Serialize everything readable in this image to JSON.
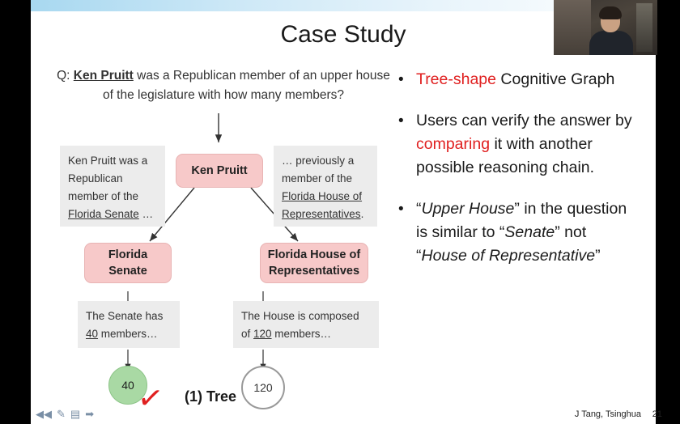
{
  "slide": {
    "title": "Case Study",
    "page_number": "21",
    "attribution": "J Tang, Tsinghua"
  },
  "question": {
    "prefix": "Q: ",
    "entity": "Ken Pruitt",
    "rest": " was a Republican member of an upper house of the legislature with how many members?"
  },
  "graph": {
    "caption": "(1) Tree",
    "check_mark": "✓",
    "left_context_box": {
      "line1": "Ken Pruitt was a",
      "line2": "Republican",
      "line3": "member of the",
      "underlined": "Florida Senate",
      "tail": " …"
    },
    "root_node": "Ken Pruitt",
    "right_context_box": {
      "line1": "… previously a",
      "line2": "member of the",
      "underlined1": "Florida House of",
      "underlined2": "Representatives",
      "tail": "."
    },
    "left_node_line1": "Florida",
    "left_node_line2": "Senate",
    "right_node_line1": "Florida House of",
    "right_node_line2": "Representatives",
    "left_evidence": {
      "pre": "The Senate has ",
      "number": "40",
      "post": " members…"
    },
    "right_evidence": {
      "pre": "The House is composed",
      "pre2": "of ",
      "number": "120",
      "post": " members…"
    },
    "left_answer": "40",
    "right_answer": "120"
  },
  "bullets": [
    {
      "marker": "•",
      "segments": [
        {
          "text": "Tree-shape",
          "style": "red"
        },
        {
          "text": " Cognitive Graph",
          "style": "plain"
        }
      ]
    },
    {
      "marker": "•",
      "segments": [
        {
          "text": "Users can verify the answer by ",
          "style": "plain"
        },
        {
          "text": "comparing",
          "style": "red"
        },
        {
          "text": " it with another possible reasoning chain.",
          "style": "plain"
        }
      ]
    },
    {
      "marker": "•",
      "segments": [
        {
          "text": "“",
          "style": "plain"
        },
        {
          "text": "Upper House",
          "style": "ital"
        },
        {
          "text": "” in the question is similar to “",
          "style": "plain"
        },
        {
          "text": "Senate",
          "style": "ital"
        },
        {
          "text": "” not “",
          "style": "plain"
        },
        {
          "text": "House of Representative",
          "style": "ital"
        },
        {
          "text": "”",
          "style": "plain"
        }
      ]
    }
  ],
  "controls": {
    "prev_icon": "◀◀",
    "pen_icon": "✎",
    "screen_icon": "▤",
    "next_icon": "➡"
  }
}
